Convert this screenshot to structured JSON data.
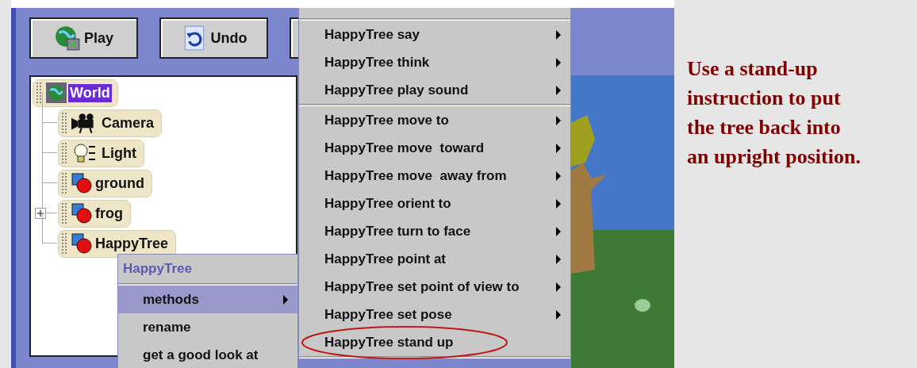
{
  "toolbar": {
    "buttons": [
      {
        "label": "Play",
        "kind": "play"
      },
      {
        "label": "Undo",
        "kind": "undo"
      }
    ]
  },
  "object_tree": {
    "root": {
      "label": "World",
      "kind": "world",
      "selected": true,
      "children": [
        {
          "label": "Camera",
          "kind": "camera",
          "selected": false
        },
        {
          "label": "Light",
          "kind": "light",
          "selected": false
        },
        {
          "label": "ground",
          "kind": "object",
          "selected": false
        },
        {
          "label": "frog",
          "kind": "object",
          "selected": false,
          "expanded": false
        },
        {
          "label": "HappyTree",
          "kind": "object",
          "selected": false
        }
      ]
    }
  },
  "context_menu": {
    "title": "HappyTree",
    "items": [
      {
        "label": "methods",
        "selected": true,
        "submenu": true
      },
      {
        "label": "rename",
        "selected": false,
        "submenu": false
      },
      {
        "label": "get a good look at",
        "selected": false,
        "submenu": false
      }
    ]
  },
  "methods_menu": {
    "groups": [
      [
        {
          "label": "HappyTree say",
          "submenu": true,
          "circled": false
        },
        {
          "label": "HappyTree think",
          "submenu": true,
          "circled": false
        },
        {
          "label": "HappyTree play sound",
          "submenu": true,
          "circled": false
        }
      ],
      [
        {
          "label": "HappyTree move to",
          "submenu": true,
          "circled": false
        },
        {
          "label": "HappyTree move  toward",
          "submenu": true,
          "circled": false
        },
        {
          "label": "HappyTree move  away from",
          "submenu": true,
          "circled": false
        },
        {
          "label": "HappyTree orient to",
          "submenu": true,
          "circled": false
        },
        {
          "label": "HappyTree turn to face",
          "submenu": true,
          "circled": false
        },
        {
          "label": "HappyTree point at",
          "submenu": true,
          "circled": false
        },
        {
          "label": "HappyTree set point of view to",
          "submenu": true,
          "circled": false
        },
        {
          "label": "HappyTree set pose",
          "submenu": true,
          "circled": false
        },
        {
          "label": "HappyTree stand up",
          "submenu": false,
          "circled": true
        }
      ]
    ]
  },
  "callout": {
    "lines": [
      "Use a stand-up",
      "instruction to put",
      "the tree back into",
      "an upright position."
    ]
  }
}
